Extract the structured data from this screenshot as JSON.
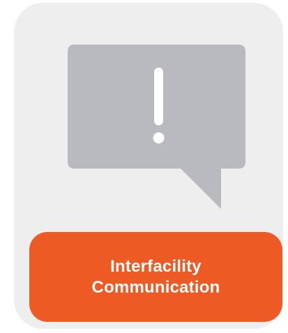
{
  "tile": {
    "background_color": "#eeeeee",
    "icon": {
      "name": "alert-speech-bubble-icon",
      "bubble_color": "#b8babf",
      "glyph_color": "#ffffff"
    },
    "label": {
      "text": "Interfacility\nCommunication",
      "background_color": "#ee5a24",
      "text_color": "#ffffff"
    }
  }
}
